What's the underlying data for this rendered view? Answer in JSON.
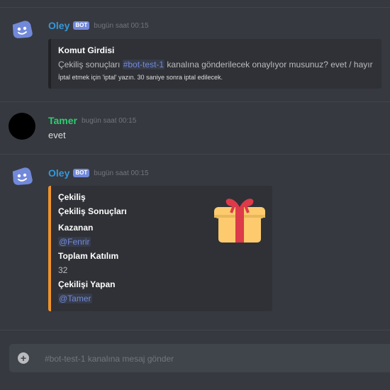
{
  "messages": [
    {
      "author": "Oley",
      "badge": "BOT",
      "timestamp": "bugün saat 00:15",
      "embed": {
        "title": "Komut Girdisi",
        "desc_before": "Çekiliş sonuçları ",
        "channel_mention": "#bot-test-1",
        "desc_after": " kanalına gönderilecek onaylıyor musunuz? evet / hayır",
        "footer": "İptal etmek için 'iptal' yazın. 30 saniye sonra iptal edilecek."
      }
    },
    {
      "author": "Tamer",
      "timestamp": "bugün saat 00:15",
      "content": "evet"
    },
    {
      "author": "Oley",
      "badge": "BOT",
      "timestamp": "bugün saat 00:15",
      "embed": {
        "title": "Çekiliş",
        "subtitle": "Çekiliş Sonuçları",
        "fields": [
          {
            "name": "Kazanan",
            "value": "@Fenrir"
          },
          {
            "name": "Toplam Katılım",
            "value": "32"
          },
          {
            "name": "Çekilişi Yapan",
            "value": "@Tamer"
          }
        ],
        "accent_color": "#f0932b",
        "thumbnail_icon": "gift-icon"
      }
    }
  ],
  "input": {
    "placeholder": "#bot-test-1 kanalına mesaj gönder",
    "value": ""
  },
  "colors": {
    "bot_name": "#3498db",
    "user_name": "#2ecc71",
    "background": "#36393f",
    "embed_bg": "#2f3136",
    "mention": "#7289da"
  }
}
